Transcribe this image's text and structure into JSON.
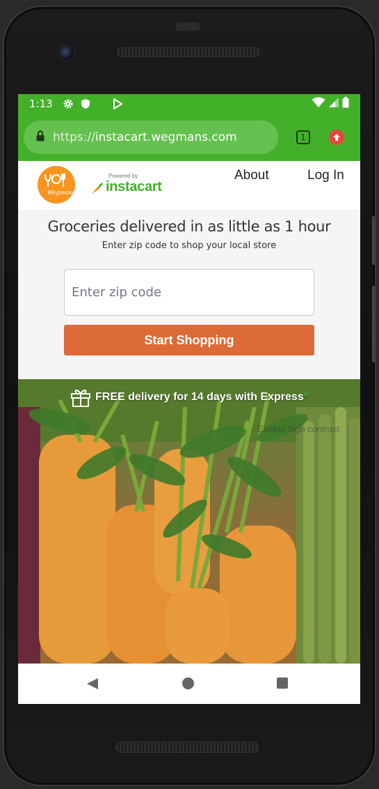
{
  "status_bar": {
    "time": "1:13",
    "icons": [
      "settings-icon",
      "shield-icon",
      "play-store-icon",
      "wifi-icon",
      "signal-icon",
      "battery-icon"
    ]
  },
  "browser": {
    "url_scheme": "https://",
    "url_host": "instacart.wegmans.com",
    "tab_count": "1",
    "icons": [
      "lock-icon",
      "update-icon"
    ]
  },
  "header": {
    "logo_text": "Wegmans",
    "powered_by": "Powered by",
    "instacart": "instacart",
    "nav": {
      "about": "About",
      "login": "Log In"
    }
  },
  "hero": {
    "title": "Groceries delivered in as little as 1 hour",
    "subtitle": "Enter zip code to shop your local store",
    "zip_placeholder": "Enter zip code",
    "start_button": "Start Shopping"
  },
  "promo": {
    "banner": "FREE delivery for 14 days with Express",
    "asterisk": "*",
    "contrast": "Enable high contrast"
  },
  "colors": {
    "instacart_green": "#43b02a",
    "start_button": "#dc6b38",
    "wegmans_orange": "#f7951e"
  }
}
